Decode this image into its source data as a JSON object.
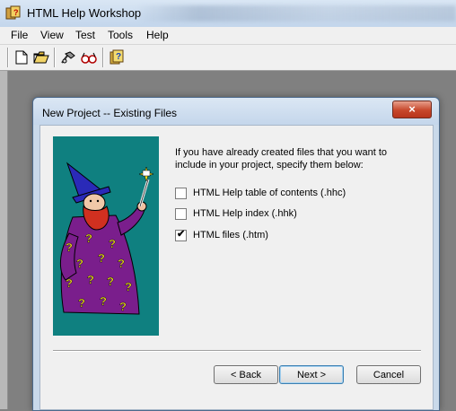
{
  "app": {
    "title": "HTML Help Workshop"
  },
  "menu": [
    "File",
    "View",
    "Test",
    "Tools",
    "Help"
  ],
  "toolbar": {
    "buttons": [
      "new-file-icon",
      "open-folder-icon",
      "compile-icon",
      "view-compiled-icon",
      "help-icon"
    ]
  },
  "dialog": {
    "title": "New Project -- Existing Files",
    "close_label": "×",
    "description": "If you have already created files that you want to include in your project, specify them below:",
    "options": [
      {
        "label": "HTML Help table of contents (.hhc)",
        "checked": false
      },
      {
        "label": "HTML Help index (.hhk)",
        "checked": false
      },
      {
        "label": "HTML files (.htm)",
        "checked": true
      }
    ],
    "buttons": {
      "back": "< Back",
      "next": "Next >",
      "cancel": "Cancel"
    }
  },
  "colors": {
    "wizard_background": "#0f8080",
    "robe": "#7a1e8c",
    "hat": "#2a2ab8",
    "beard": "#d03020",
    "question_marks": "#f0e020"
  }
}
